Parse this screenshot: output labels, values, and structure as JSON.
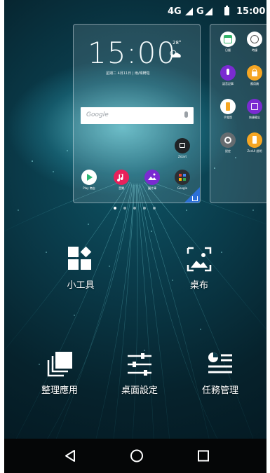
{
  "status_bar": {
    "network_1": "4G",
    "network_2": "G",
    "time": "15:00"
  },
  "preview_main": {
    "clock": "15:00",
    "temperature": "28°",
    "date": "星期二 4月11日 | 雨/晴轉陰",
    "search_placeholder": "Google",
    "apps": [
      {
        "label": "Play 商店",
        "icon": "play-store-icon",
        "color": "#ffffff"
      },
      {
        "label": "音樂",
        "icon": "music-icon",
        "color": "#e8205b"
      },
      {
        "label": "圖片庫",
        "icon": "gallery-icon",
        "color": "#7a2bd1"
      },
      {
        "label": "Google",
        "icon": "google-folder-icon",
        "color": "#2c2f33"
      }
    ],
    "folder_label": "Zstart"
  },
  "preview_side": {
    "apps": [
      {
        "label": "日曆",
        "icon": "calendar-icon",
        "color": "#ffffff"
      },
      {
        "label": "時鐘",
        "icon": "clock-icon",
        "color": "#ffffff"
      },
      {
        "label": "語音記事",
        "icon": "voice-recorder-icon",
        "color": "#7a2bd1"
      },
      {
        "label": "應用鎖",
        "icon": "app-lock-icon",
        "color": "#f5a623"
      },
      {
        "label": "手電筒",
        "icon": "flashlight-icon",
        "color": "#ffffff"
      },
      {
        "label": "快捷備忘",
        "icon": "memo-icon",
        "color": "#7a2bd1"
      },
      {
        "label": "設定",
        "icon": "settings-icon",
        "color": "#666c70"
      },
      {
        "label": "ZenUI 說明",
        "icon": "zenui-help-icon",
        "color": "#f5a623"
      }
    ]
  },
  "actions": {
    "widgets": "小工具",
    "wallpaper": "桌布",
    "organize_apps": "整理應用",
    "home_settings": "桌面設定",
    "task_manager": "任務管理"
  },
  "colors": {
    "accent": "#2b6fd6",
    "navbar": "#050607"
  }
}
